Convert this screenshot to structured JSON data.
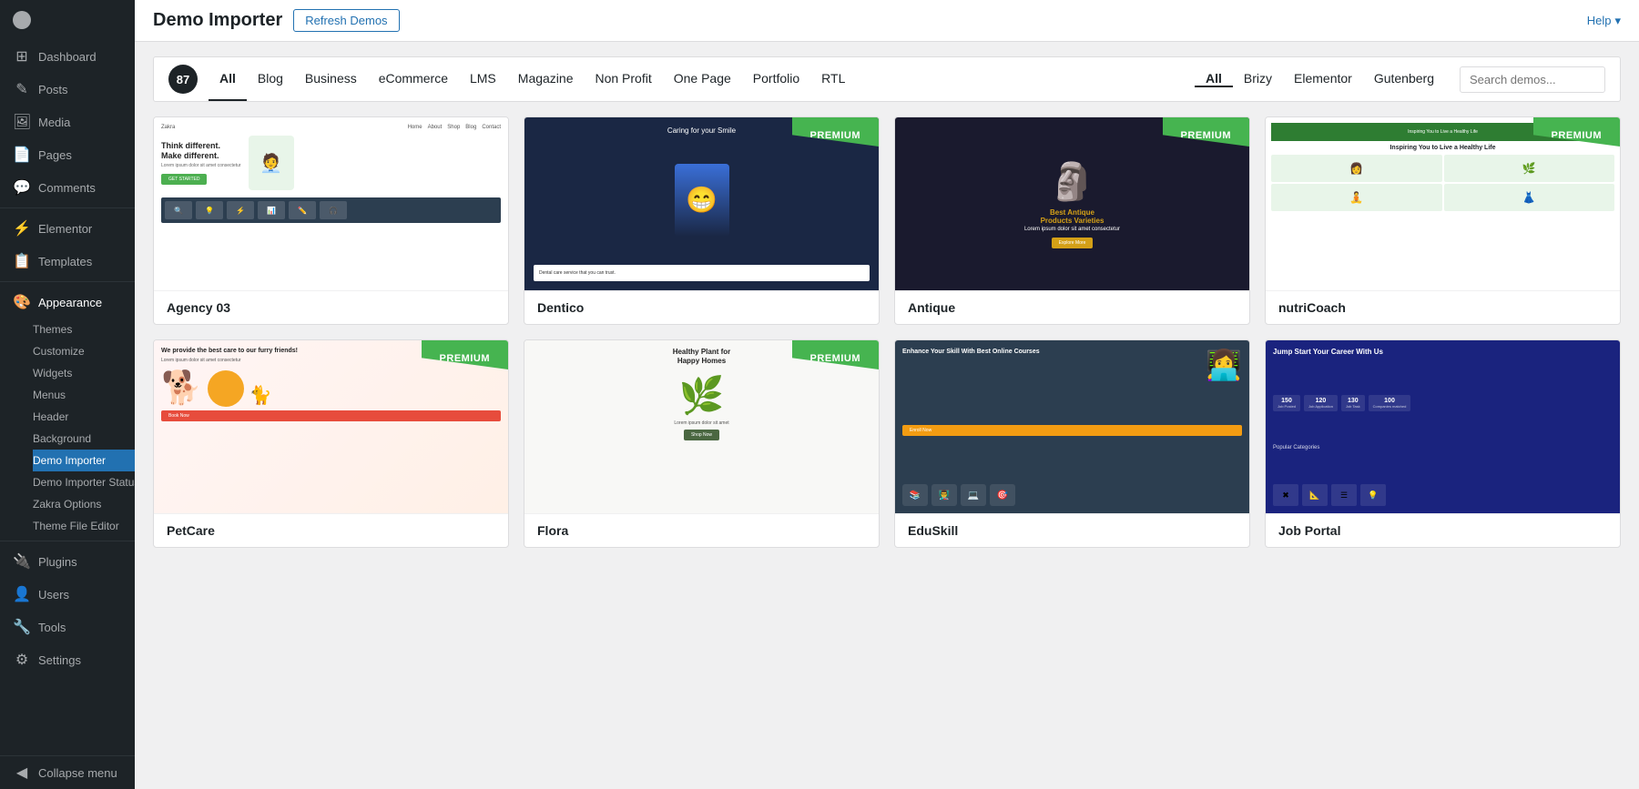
{
  "sidebar": {
    "items": [
      {
        "id": "dashboard",
        "label": "Dashboard",
        "icon": "⊞"
      },
      {
        "id": "posts",
        "label": "Posts",
        "icon": "✎"
      },
      {
        "id": "media",
        "label": "Media",
        "icon": "🖼"
      },
      {
        "id": "pages",
        "label": "Pages",
        "icon": "📄"
      },
      {
        "id": "comments",
        "label": "Comments",
        "icon": "💬"
      },
      {
        "id": "elementor",
        "label": "Elementor",
        "icon": "⚡"
      },
      {
        "id": "templates",
        "label": "Templates",
        "icon": "📋"
      },
      {
        "id": "appearance",
        "label": "Appearance",
        "icon": "🎨"
      },
      {
        "id": "plugins",
        "label": "Plugins",
        "icon": "🔌"
      },
      {
        "id": "users",
        "label": "Users",
        "icon": "👤"
      },
      {
        "id": "tools",
        "label": "Tools",
        "icon": "🔧"
      },
      {
        "id": "settings",
        "label": "Settings",
        "icon": "⚙"
      }
    ],
    "appearance_sub": [
      {
        "id": "themes",
        "label": "Themes"
      },
      {
        "id": "customize",
        "label": "Customize"
      },
      {
        "id": "widgets",
        "label": "Widgets"
      },
      {
        "id": "menus",
        "label": "Menus"
      },
      {
        "id": "header",
        "label": "Header"
      },
      {
        "id": "background",
        "label": "Background"
      },
      {
        "id": "demo-importer",
        "label": "Demo Importer"
      },
      {
        "id": "demo-importer-status",
        "label": "Demo Importer Status"
      },
      {
        "id": "zakra-options",
        "label": "Zakra Options"
      },
      {
        "id": "theme-file-editor",
        "label": "Theme File Editor"
      }
    ],
    "collapse_label": "Collapse menu"
  },
  "topbar": {
    "title": "Demo Importer",
    "refresh_label": "Refresh Demos",
    "help_label": "Help"
  },
  "filter_bar": {
    "count": "87",
    "tabs": [
      {
        "id": "all",
        "label": "All",
        "active": true
      },
      {
        "id": "blog",
        "label": "Blog"
      },
      {
        "id": "business",
        "label": "Business"
      },
      {
        "id": "ecommerce",
        "label": "eCommerce"
      },
      {
        "id": "lms",
        "label": "LMS"
      },
      {
        "id": "magazine",
        "label": "Magazine"
      },
      {
        "id": "nonprofit",
        "label": "Non Profit"
      },
      {
        "id": "onepage",
        "label": "One Page"
      },
      {
        "id": "portfolio",
        "label": "Portfolio"
      },
      {
        "id": "rtl",
        "label": "RTL"
      }
    ],
    "builder_tabs": [
      {
        "id": "all",
        "label": "All",
        "active": true
      },
      {
        "id": "brizy",
        "label": "Brizy"
      },
      {
        "id": "elementor",
        "label": "Elementor"
      },
      {
        "id": "gutenberg",
        "label": "Gutenberg"
      }
    ],
    "search_placeholder": "Search demos..."
  },
  "demos": [
    {
      "id": "agency03",
      "name": "Agency 03",
      "premium": false,
      "type": "agency"
    },
    {
      "id": "dentico",
      "name": "Dentico",
      "premium": true,
      "type": "dental"
    },
    {
      "id": "antique",
      "name": "Antique",
      "premium": true,
      "type": "antique"
    },
    {
      "id": "nutricoach",
      "name": "nutriCoach",
      "premium": true,
      "type": "health"
    },
    {
      "id": "petcare",
      "name": "PetCare",
      "premium": true,
      "type": "petcare"
    },
    {
      "id": "flora",
      "name": "Flora",
      "premium": true,
      "type": "plants"
    },
    {
      "id": "eduskill",
      "name": "EduSkill",
      "premium": false,
      "type": "education"
    },
    {
      "id": "jobportal",
      "name": "Job Portal",
      "premium": false,
      "type": "jobs"
    }
  ],
  "premium_badge_label": "PREMIUM"
}
